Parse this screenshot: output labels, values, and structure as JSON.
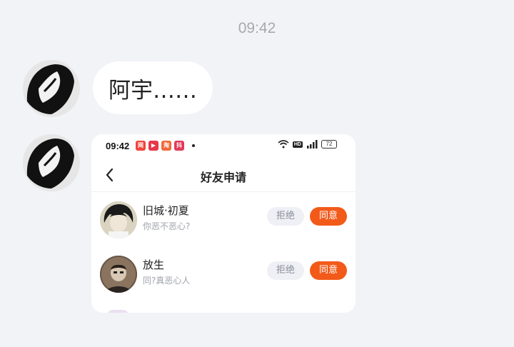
{
  "chat": {
    "timestamp": "09:42",
    "message_text": "阿宇……"
  },
  "screenshot": {
    "status_bar": {
      "time": "09:42",
      "battery": "72",
      "hd_label": "HD",
      "app_icons": [
        {
          "name": "app-icon-1",
          "color": "#f0453a",
          "glyph": "网"
        },
        {
          "name": "app-icon-2",
          "color": "#e8364a",
          "glyph": "▶"
        },
        {
          "name": "app-icon-3",
          "color": "#f06a3a",
          "glyph": "淘"
        },
        {
          "name": "app-icon-4",
          "color": "#e23a5a",
          "glyph": "抖"
        }
      ]
    },
    "nav": {
      "title": "好友申请"
    },
    "requests": [
      {
        "name": "旧城·初夏",
        "message": "你恶不恶心?",
        "reject_label": "拒绝",
        "accept_label": "同意"
      },
      {
        "name": "放生",
        "message": "同?真恶心人",
        "reject_label": "拒绝",
        "accept_label": "同意"
      }
    ]
  },
  "colors": {
    "accent": "#f25a1a",
    "background": "#f2f3f7"
  }
}
